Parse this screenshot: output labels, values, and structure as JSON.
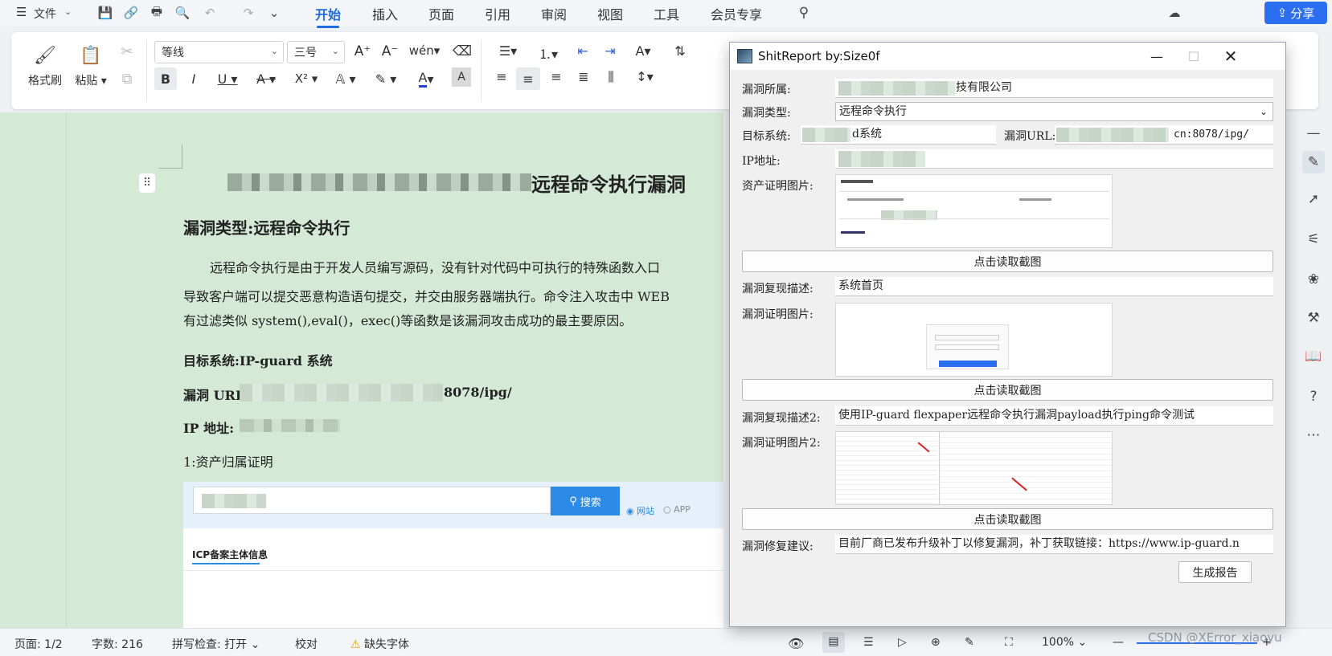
{
  "menubar": {
    "file_label": "文件",
    "tabs": [
      "开始",
      "插入",
      "页面",
      "引用",
      "审阅",
      "视图",
      "工具",
      "会员专享"
    ],
    "share_label": "分享"
  },
  "ribbon": {
    "format_painter": "格式刷",
    "paste": "粘贴",
    "font_name": "等线",
    "font_size": "三号"
  },
  "document": {
    "title_visible": "远程命令执行漏洞",
    "vuln_type_heading": "漏洞类型:远程命令执行",
    "para_line1": "远程命令执行是由于开发人员编写源码，没有针对代码中可执行的特殊函数入口",
    "para_line2": "导致客户端可以提交恶意构造语句提交，并交由服务器端执行。命令注入攻击中 WEB",
    "para_line3": "有过滤类似 system(),eval()，exec()等函数是该漏洞攻击成功的最主要原因。",
    "target_system": "目标系统:IP-guard 系统",
    "vuln_url_label": "漏洞 URL:",
    "vuln_url_suffix": "8078/ipg/",
    "ip_label": "IP 地址:",
    "asset_proof": "1:资产归属证明",
    "icp_search_btn": "搜索",
    "icp_radio_site": "网站",
    "icp_radio_app": "APP",
    "icp_section_title": "ICP备案主体信息"
  },
  "statusbar": {
    "page": "页面: 1/2",
    "words": "字数: 216",
    "spellcheck": "拼写检查: 打开",
    "proofread": "校对",
    "missing_font": "缺失字体",
    "zoom": "100%",
    "watermark": "CSDN @XError_xiaoyu"
  },
  "dialog": {
    "title": "ShitReport by:Size0f",
    "fields": {
      "vuln_owner_label": "漏洞所属:",
      "vuln_owner_value": "技有限公司",
      "vuln_type_label": "漏洞类型:",
      "vuln_type_value": "远程命令执行",
      "target_label": "目标系统:",
      "target_value": "d系统",
      "url_label": "漏洞URL:",
      "url_value": "cn:8078/ipg/",
      "ip_label": "IP地址:",
      "asset_img_label": "资产证明图片:",
      "read_screenshot": "点击读取截图",
      "repro_desc_label": "漏洞复现描述:",
      "repro_desc_value": "系统首页",
      "proof_img_label": "漏洞证明图片:",
      "repro_desc2_label": "漏洞复现描述2:",
      "repro_desc2_value": "使用IP-guard flexpaper远程命令执行漏洞payload执行ping命令测试",
      "proof_img2_label": "漏洞证明图片2:",
      "fix_label": "漏洞修复建议:",
      "fix_value": "目前厂商已发布升级补丁以修复漏洞，补丁获取链接：https://www.ip-guard.n",
      "generate_report": "生成报告"
    }
  }
}
